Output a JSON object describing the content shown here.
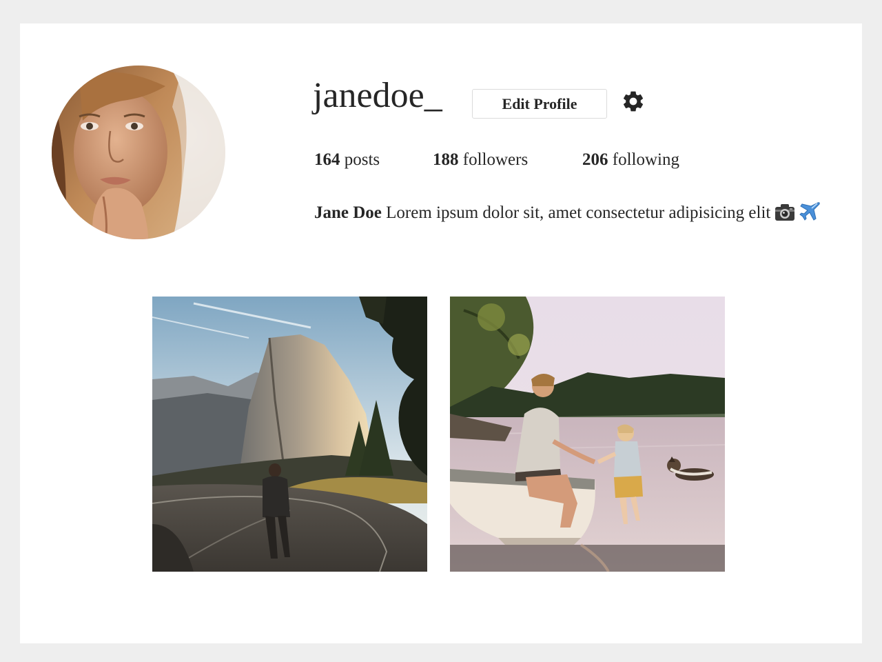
{
  "profile": {
    "username": "janedoe_",
    "edit_button_label": "Edit Profile",
    "settings_icon": "gear-icon",
    "avatar_icon": "avatar"
  },
  "stats": {
    "posts": {
      "count": "164",
      "label": "posts"
    },
    "followers": {
      "count": "188",
      "label": "followers"
    },
    "following": {
      "count": "206",
      "label": "following"
    }
  },
  "bio": {
    "name": "Jane Doe",
    "text": "Lorem ipsum dolor sit, amet consectetur adipisicing elit",
    "emojis": [
      "camera-icon",
      "airplane-icon"
    ]
  },
  "gallery": {
    "posts": [
      {
        "subject": "mountain-road-photo"
      },
      {
        "subject": "lake-boat-photo"
      }
    ]
  },
  "colors": {
    "page_background": "#eeeeee",
    "card_background": "#ffffff",
    "text": "#262626",
    "button_border": "#dbdbdb"
  }
}
